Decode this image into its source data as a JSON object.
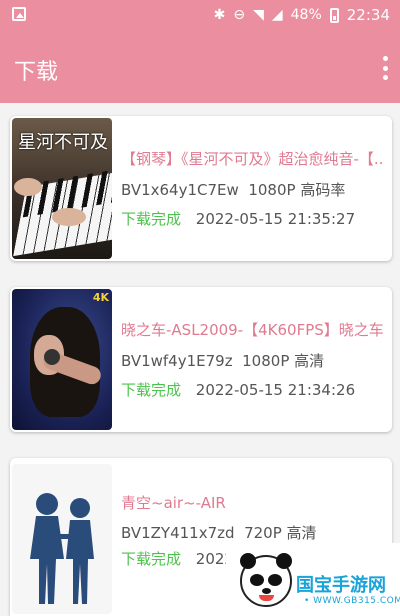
{
  "status_bar": {
    "battery": "48%",
    "time": "22:34"
  },
  "app_bar": {
    "title": "下载"
  },
  "downloads": [
    {
      "thumbnail_text": "星河不可及",
      "title": "【钢琴】《星河不可及》超治愈纯音-【...",
      "id": "BV1x64y1C7Ew",
      "quality": "1080P 高码率",
      "status": "下载完成",
      "time": "2022-05-15 21:35:27"
    },
    {
      "thumbnail_text": "4K",
      "title": "晓之车-ASL2009-【4K60FPS】晓之车-...",
      "id": "BV1wf4y1E79z",
      "quality": "1080P 高清",
      "status": "下载完成",
      "time": "2022-05-15 21:34:26"
    },
    {
      "title": "青空~air~-AIR",
      "id": "BV1ZY411x7zd",
      "quality": "720P 高清",
      "status": "下载完成",
      "time": "2022"
    }
  ],
  "watermark": {
    "name": "国宝手游网",
    "url": "• WWW.GB315.COM •"
  },
  "colors": {
    "accent": "#eb8fa0",
    "title_pink": "#e07a90",
    "done_green": "#4ec24e"
  }
}
